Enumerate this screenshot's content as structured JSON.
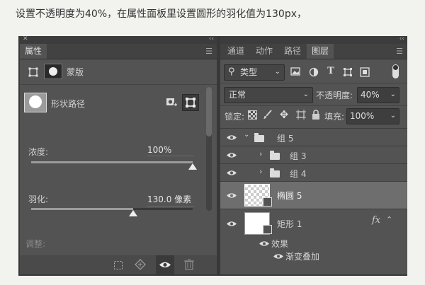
{
  "caption": "设置不透明度为40%，在属性面板里设置圆形的羽化值为130px，",
  "left_panel": {
    "top_close": "✕",
    "top_collapse": "‹‹",
    "tab_label": "属性",
    "mask_label": "蒙版",
    "shape_path_label": "形状路径",
    "density": {
      "label": "浓度:",
      "value": "100%",
      "level": 1.0
    },
    "feather": {
      "label": "羽化:",
      "value": "130.0 像素",
      "level": 0.63
    },
    "adjust_label": "调整:"
  },
  "right_panel": {
    "top_collapse": "‹‹",
    "tabs": [
      "通道",
      "动作",
      "路径",
      "图层"
    ],
    "active_tab": "图层",
    "filter_label": "类型",
    "blend_mode": "正常",
    "opacity_label": "不透明度:",
    "opacity_value": "40%",
    "lock_label": "锁定:",
    "fill_label": "填充:",
    "fill_value": "100%",
    "layers": [
      {
        "name": "组 5",
        "type": "group",
        "indent": 0,
        "expanded": true
      },
      {
        "name": "组 3",
        "type": "group",
        "indent": 1,
        "expanded": false
      },
      {
        "name": "组 4",
        "type": "group",
        "indent": 1,
        "expanded": false
      },
      {
        "name": "椭圆 5",
        "type": "shape",
        "selected": true
      },
      {
        "name": "矩形 1",
        "type": "shape",
        "fx": "fx"
      }
    ],
    "effects_label": "效果",
    "effect_item": "渐变叠加"
  }
}
